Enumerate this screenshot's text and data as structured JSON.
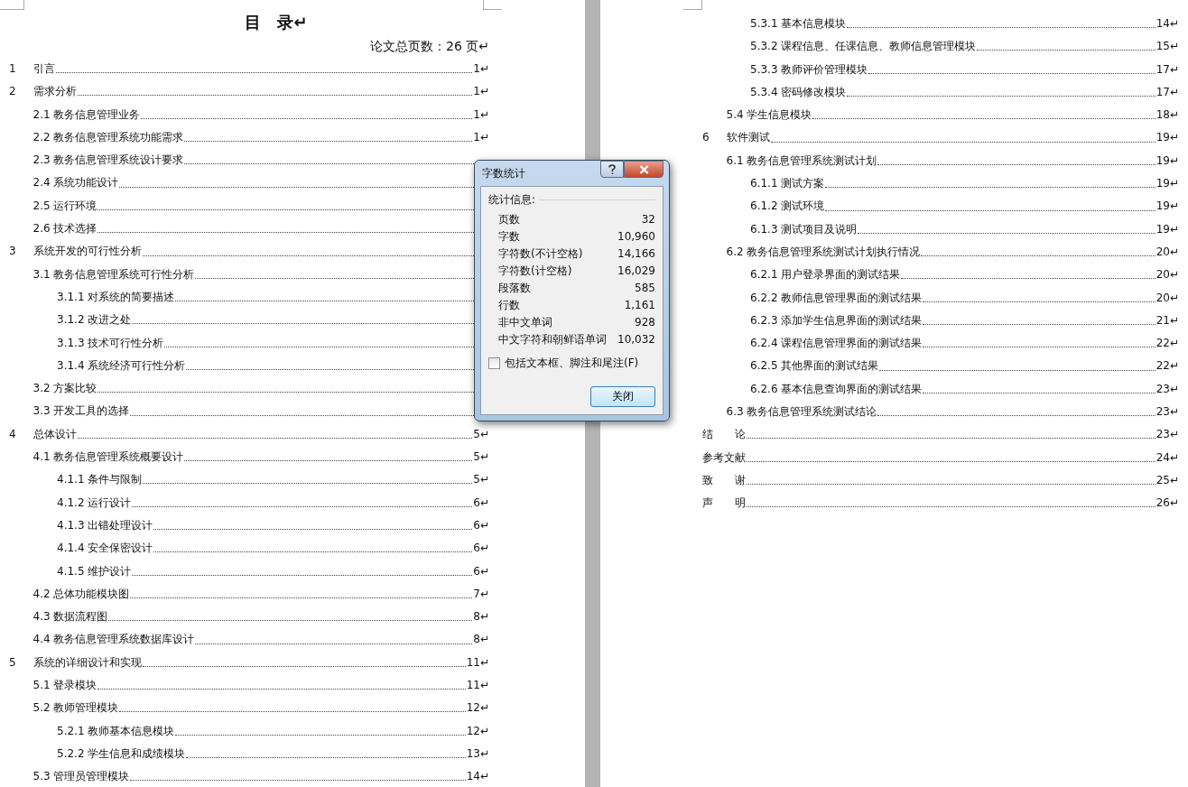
{
  "document": {
    "left_page": {
      "title": "目　录↵",
      "total_pages": "论文总页数：26 页↵",
      "entries": [
        {
          "number": "1",
          "title": "引言",
          "page": "1↵"
        },
        {
          "number": "2",
          "title": "需求分析",
          "page": "1↵",
          "children": [
            {
              "title": "2.1 教务信息管理业务",
              "page": "1↵"
            },
            {
              "title": "2.2 教务信息管理系统功能需求",
              "page": "1↵"
            },
            {
              "title": "2.3 教务信息管理系统设计要求"
            },
            {
              "title": "2.4 系统功能设计"
            },
            {
              "title": "2.5 运行环境"
            },
            {
              "title": "2.6 技术选择"
            }
          ]
        },
        {
          "number": "3",
          "title": "系统开发的可行性分析",
          "children": [
            {
              "title": "3.1 教务信息管理系统可行性分析",
              "children": [
                {
                  "title": "3.1.1 对系统的简要描述"
                },
                {
                  "title": "3.1.2 改进之处"
                },
                {
                  "title": "3.1.3 技术可行性分析"
                },
                {
                  "title": "3.1.4 系统经济可行性分析"
                }
              ]
            },
            {
              "title": "3.2 方案比较"
            },
            {
              "title": "3.3 开发工具的选择"
            }
          ]
        },
        {
          "number": "4",
          "title": "总体设计",
          "page": "5↵",
          "children": [
            {
              "title": "4.1 教务信息管理系统概要设计",
              "page": "5↵",
              "children": [
                {
                  "title": "4.1.1 条件与限制",
                  "page": "5↵"
                },
                {
                  "title": "4.1.2 运行设计",
                  "page": "6↵"
                },
                {
                  "title": "4.1.3 出错处理设计",
                  "page": "6↵"
                },
                {
                  "title": "4.1.4 安全保密设计",
                  "page": "6↵"
                },
                {
                  "title": "4.1.5 维护设计",
                  "page": "6↵"
                }
              ]
            },
            {
              "title": "4.2 总体功能模块图",
              "page": "7↵"
            },
            {
              "title": "4.3 数据流程图",
              "page": "8↵"
            },
            {
              "title": "4.4 教务信息管理系统数据库设计",
              "page": "8↵"
            }
          ]
        },
        {
          "number": "5",
          "title": "系统的详细设计和实现",
          "page": "11↵",
          "children": [
            {
              "title": "5.1 登录模块",
              "page": "11↵"
            },
            {
              "title": "5.2 教师管理模块",
              "page": "12↵",
              "children": [
                {
                  "title": "5.2.1 教师基本信息模块",
                  "page": "12↵"
                },
                {
                  "title": "5.2.2 学生信息和成绩模块",
                  "page": "13↵"
                }
              ]
            },
            {
              "title": "5.3 管理员管理模块",
              "page": "14↵"
            }
          ]
        }
      ]
    },
    "right_page": {
      "entries": [
        {
          "children": [
            {
              "children": [
                {
                  "title": "5.3.1 基本信息模块",
                  "page": "14↵"
                },
                {
                  "title": "5.3.2 课程信息、任课信息、教师信息管理模块",
                  "page": "15↵"
                },
                {
                  "title": "5.3.3 教师评价管理模块",
                  "page": "17↵"
                },
                {
                  "title": "5.3.4 密码修改模块",
                  "page": "17↵"
                }
              ]
            },
            {
              "title": "5.4 学生信息模块",
              "page": "18↵"
            }
          ]
        },
        {
          "number": "6",
          "title": "软件测试",
          "page": "19↵",
          "children": [
            {
              "title": "6.1 教务信息管理系统测试计划",
              "page": "19↵",
              "children": [
                {
                  "title": "6.1.1 测试方案",
                  "page": "19↵"
                },
                {
                  "title": "6.1.2 测试环境",
                  "page": "19↵"
                },
                {
                  "title": "6.1.3 测试项目及说明",
                  "page": "19↵"
                }
              ]
            },
            {
              "title": "6.2 教务信息管理系统测试计划执行情况",
              "page": "20↵",
              "children": [
                {
                  "title": "6.2.1 用户登录界面的测试结果",
                  "page": "20↵"
                },
                {
                  "title": "6.2.2  教师信息管理界面的测试结果",
                  "page": "20↵"
                },
                {
                  "title": "6.2.3 添加学生信息界面的测试结果",
                  "page": "21↵"
                },
                {
                  "title": "6.2.4 课程信息管理界面的测试结果",
                  "page": "22↵"
                },
                {
                  "title": "6.2.5 其他界面的测试结果",
                  "page": "22↵"
                },
                {
                  "title": "6.2.6 基本信息查询界面的测试结果",
                  "page": "23↵"
                }
              ]
            },
            {
              "title": "6.3 教务信息管理系统测试结论",
              "page": "23↵"
            }
          ]
        },
        {
          "title": "结　　论",
          "page": "23↵"
        },
        {
          "title": "参考文献",
          "page": "24↵"
        },
        {
          "title": "致　　谢",
          "page": "25↵"
        },
        {
          "title": "声　　明",
          "page": "26↵"
        }
      ]
    }
  },
  "dialog": {
    "title": "字数统计",
    "group": "统计信息:",
    "stats": [
      {
        "label": "页数",
        "value": "32"
      },
      {
        "label": "字数",
        "value": "10,960"
      },
      {
        "label": "字符数(不计空格)",
        "value": "14,166"
      },
      {
        "label": "字符数(计空格)",
        "value": "16,029"
      },
      {
        "label": "段落数",
        "value": "585"
      },
      {
        "label": "行数",
        "value": "1,161"
      },
      {
        "label": "非中文单词",
        "value": "928"
      },
      {
        "label": "中文字符和朝鲜语单词",
        "value": "10,032"
      }
    ],
    "checkbox": {
      "label": "包括文本框、脚注和尾注(F)",
      "checked": false
    },
    "button": "关闭"
  }
}
